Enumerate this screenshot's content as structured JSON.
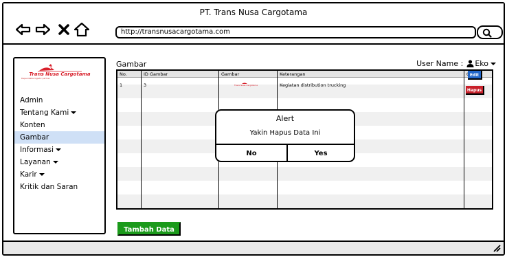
{
  "window": {
    "title": "PT. Trans Nusa Cargotama"
  },
  "browser": {
    "url": "http://transnusacargotama.com",
    "nav": [
      "back-icon",
      "forward-icon",
      "close-icon",
      "home-icon"
    ],
    "search_icon": "search-icon"
  },
  "sidebar": {
    "logo": {
      "name": "Trans Nusa Cargotama",
      "tagline": "Dependable logistic partner"
    },
    "items": [
      {
        "label": "Admin",
        "dropdown": false,
        "active": false
      },
      {
        "label": "Tentang Kami",
        "dropdown": true,
        "active": false
      },
      {
        "label": "Konten",
        "dropdown": false,
        "active": false
      },
      {
        "label": "Gambar",
        "dropdown": false,
        "active": true
      },
      {
        "label": "Informasi",
        "dropdown": true,
        "active": false
      },
      {
        "label": "Layanan",
        "dropdown": true,
        "active": false
      },
      {
        "label": "Karir",
        "dropdown": true,
        "active": false
      },
      {
        "label": "Kritik dan Saran",
        "dropdown": false,
        "active": false
      }
    ]
  },
  "main": {
    "title": "Gambar",
    "user_label": "User Name :",
    "user_name": "Eko",
    "table": {
      "headers": [
        "No.",
        "ID Gambar",
        "Gambar",
        "Keterangan",
        "Opsi"
      ],
      "rows": [
        {
          "no": "1",
          "id": "3",
          "image": "Trans Nusa Cargotama",
          "keterangan": "Kegiatan distribution trucking"
        }
      ]
    },
    "edit_label": "Edit",
    "delete_label": "Hapus",
    "add_label": "Tambah Data"
  },
  "alert": {
    "title": "Alert",
    "message": "Yakin Hapus Data Ini",
    "no_label": "No",
    "yes_label": "Yes"
  },
  "colors": {
    "active_menu": "#cfe0f6",
    "edit_button": "#2166c9",
    "delete_button": "#c8202a",
    "add_button": "#1b9a1b",
    "brand_red": "#d81f2a"
  }
}
